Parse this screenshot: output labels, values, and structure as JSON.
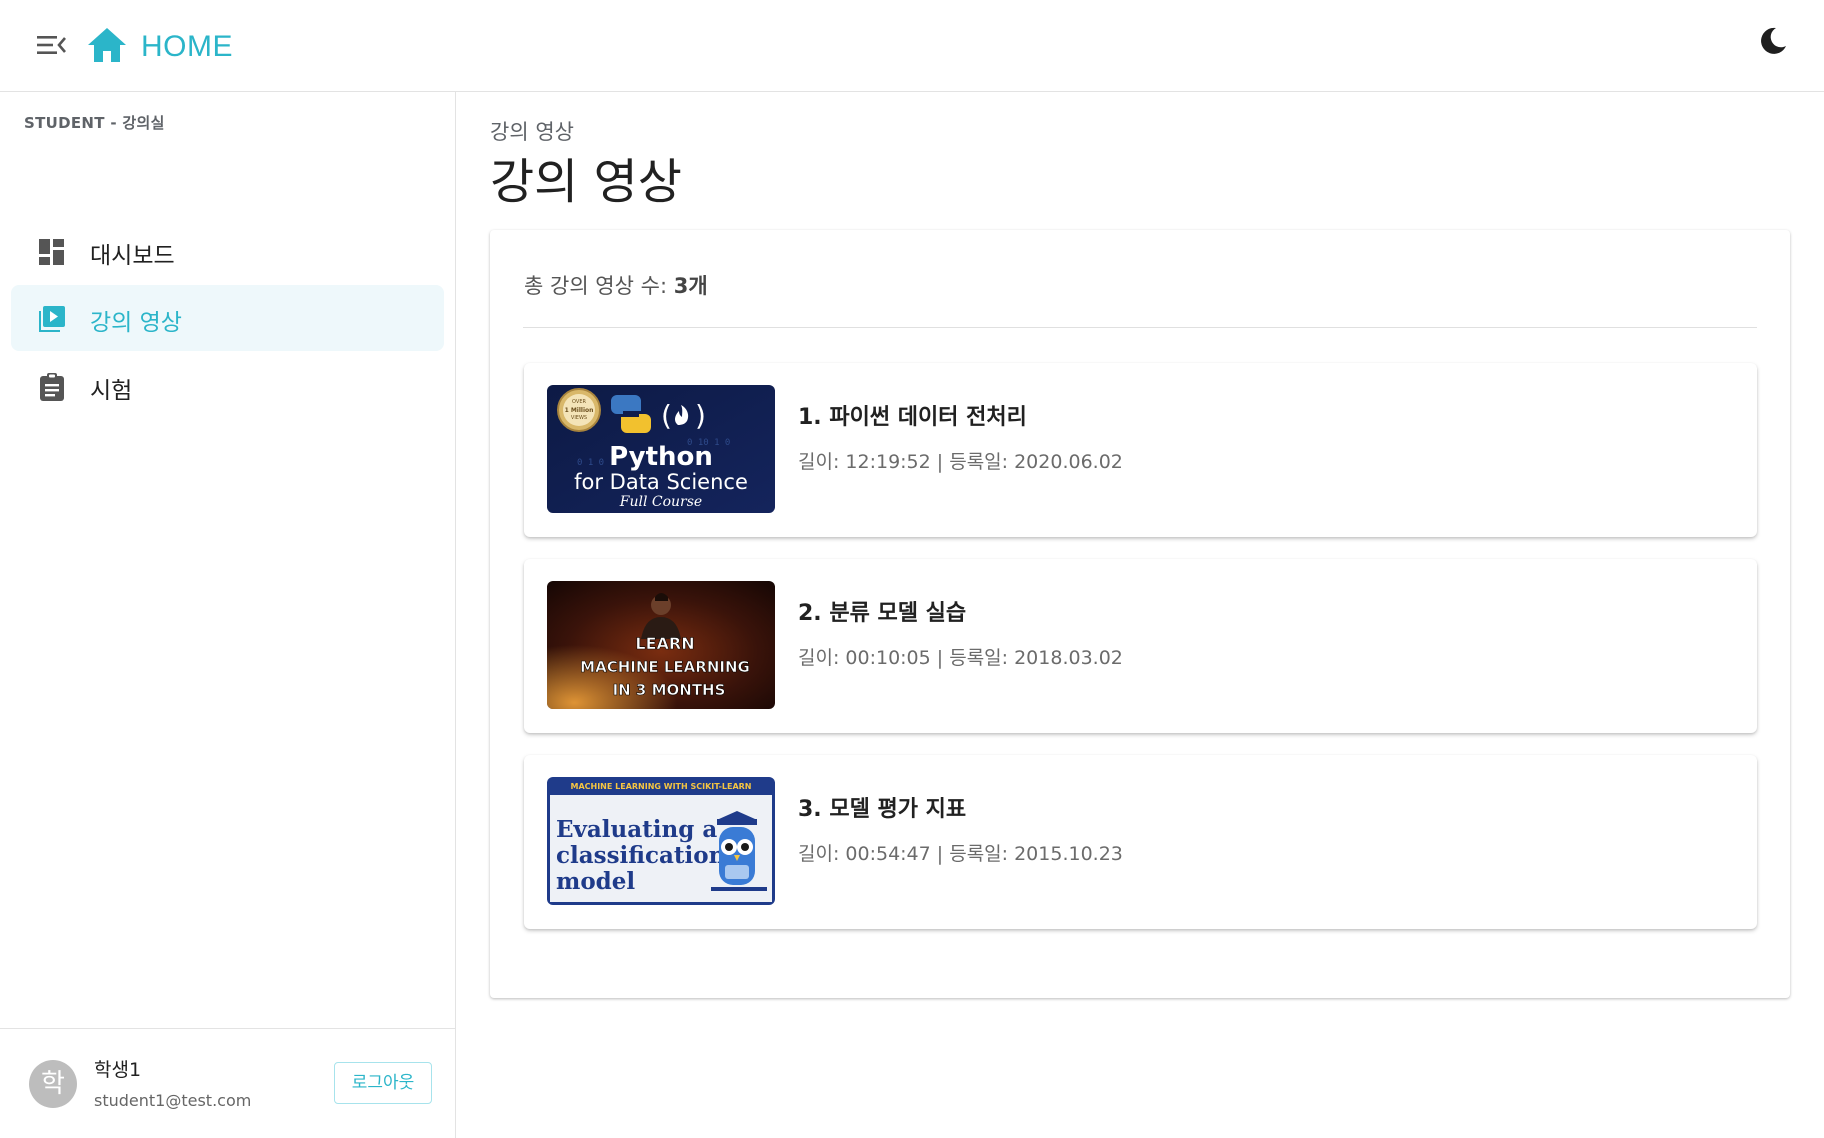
{
  "header": {
    "menu_icon": "menu-collapse-icon",
    "home_icon": "home-icon",
    "home_label": "HOME",
    "theme_icon": "moon-icon",
    "accent_color": "#2bb5c9"
  },
  "sidebar": {
    "section_title": "STUDENT - 강의실",
    "items": [
      {
        "label": "대시보드",
        "icon": "dashboard-icon",
        "active": false
      },
      {
        "label": "강의 영상",
        "icon": "video-library-icon",
        "active": true
      },
      {
        "label": "시험",
        "icon": "clipboard-icon",
        "active": false
      }
    ],
    "user": {
      "avatar_text": "학",
      "name": "학생1",
      "email": "student1@test.com",
      "logout_label": "로그아웃"
    }
  },
  "main": {
    "breadcrumb": "강의 영상",
    "title": "강의 영상",
    "count_prefix": "총 강의 영상 수: ",
    "count_value": "3개",
    "videos": [
      {
        "title": "1. 파이썬 데이터 전처리",
        "meta": "길이: 12:19:52 | 등록일: 2020.06.02",
        "thumb": {
          "badge_top": "OVER",
          "badge_mid": "1 Million",
          "badge_bottom": "VIEWS",
          "line1": "Python",
          "line2": "for Data Science",
          "line3": "Full Course"
        }
      },
      {
        "title": "2. 분류 모델 실습",
        "meta": "길이: 00:10:05 | 등록일: 2018.03.02",
        "thumb": {
          "line1": "LEARN",
          "line2": "MACHINE LEARNING",
          "line3": "IN 3 MONTHS"
        }
      },
      {
        "title": "3. 모델 평가 지표",
        "meta": "길이: 00:54:47 | 등록일: 2015.10.23",
        "thumb": {
          "banner": "MACHINE LEARNING WITH SCIKIT-LEARN",
          "line1": "Evaluating a",
          "line2": "classification",
          "line3": "model"
        }
      }
    ]
  }
}
